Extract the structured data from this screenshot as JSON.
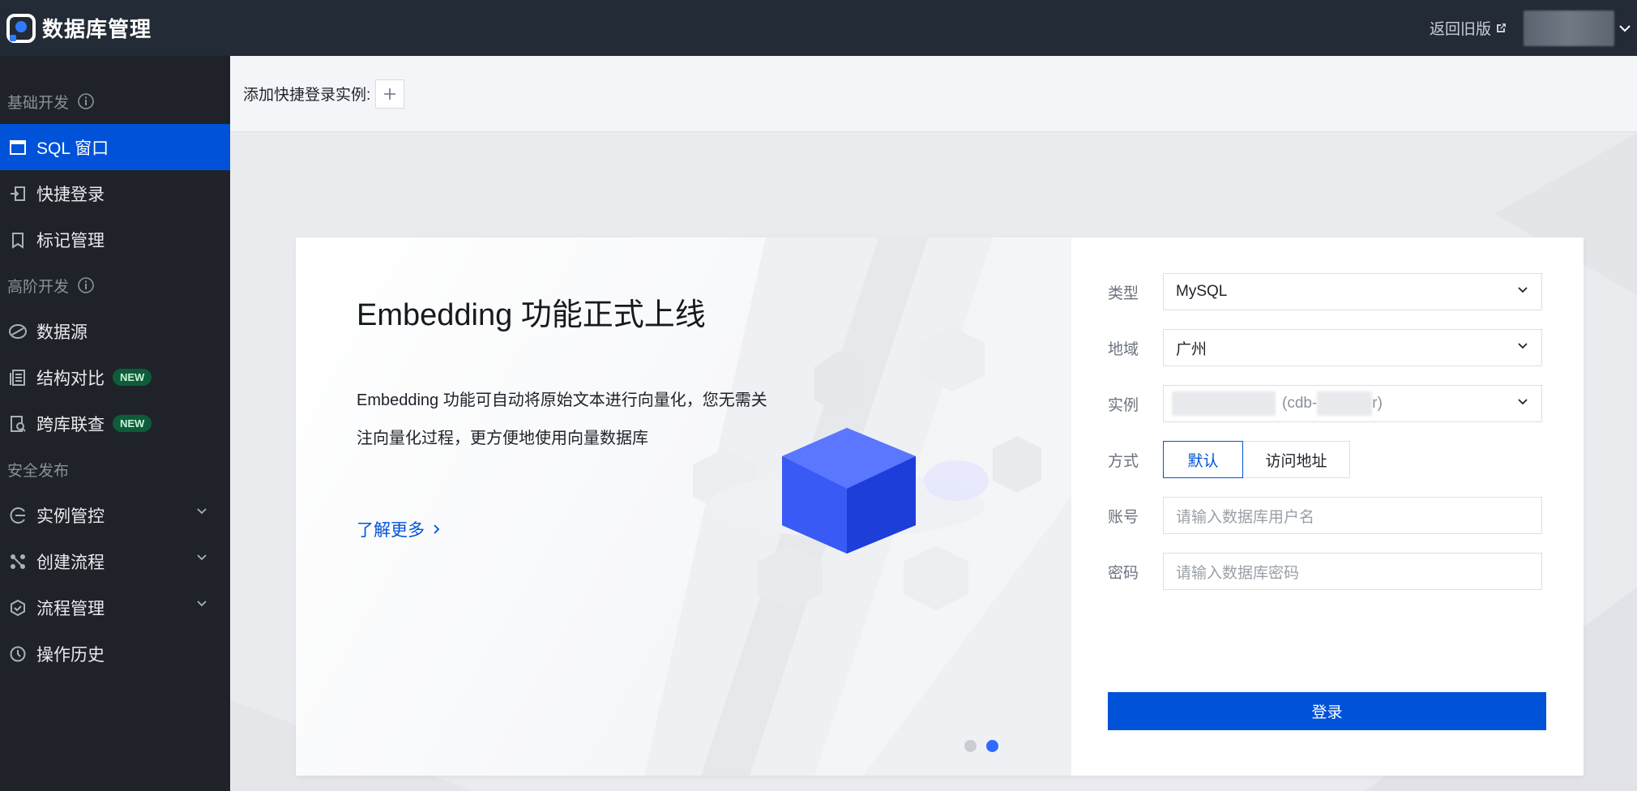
{
  "app": {
    "title": "数据库管理",
    "back_old": "返回旧版"
  },
  "colors": {
    "accent": "#0052d9",
    "topbar": "#232b36",
    "sidebar": "#1f2329",
    "new_badge": "#0e5c3a"
  },
  "sidebar": {
    "groups": [
      {
        "label": "基础开发"
      },
      {
        "label": "高阶开发"
      },
      {
        "label": "安全发布"
      }
    ],
    "items": [
      {
        "label": "SQL 窗口",
        "icon": "window-icon",
        "active": true
      },
      {
        "label": "快捷登录",
        "icon": "login-icon"
      },
      {
        "label": "标记管理",
        "icon": "bookmark-icon"
      },
      {
        "label": "数据源",
        "icon": "datasource-icon"
      },
      {
        "label": "结构对比",
        "icon": "compare-icon",
        "badge": "NEW"
      },
      {
        "label": "跨库联查",
        "icon": "cross-query-icon",
        "badge": "NEW"
      },
      {
        "label": "实例管控",
        "icon": "instance-control-icon",
        "expandable": true
      },
      {
        "label": "创建流程",
        "icon": "flow-create-icon",
        "expandable": true
      },
      {
        "label": "流程管理",
        "icon": "flow-manage-icon",
        "expandable": true
      },
      {
        "label": "操作历史",
        "icon": "history-icon"
      }
    ]
  },
  "quickbar": {
    "label": "添加快捷登录实例:"
  },
  "banner": {
    "title": "Embedding 功能正式上线",
    "desc_line1": "Embedding 功能可自动将原始文本进行向量化，您无需关",
    "desc_line2": "注向量化过程，更方便地使用向量数据库",
    "learn_more": "了解更多",
    "carousel": {
      "count": 2,
      "active_index": 1
    }
  },
  "form": {
    "type": {
      "label": "类型",
      "value": "MySQL"
    },
    "region": {
      "label": "地域",
      "value": "广州"
    },
    "instance": {
      "label": "实例",
      "value_prefix": "(cdb-",
      "value_suffix": "r)"
    },
    "method": {
      "label": "方式",
      "options": [
        "默认",
        "访问地址"
      ],
      "selected": "默认"
    },
    "account": {
      "label": "账号",
      "placeholder": "请输入数据库用户名"
    },
    "password": {
      "label": "密码",
      "placeholder": "请输入数据库密码"
    },
    "submit": "登录"
  }
}
